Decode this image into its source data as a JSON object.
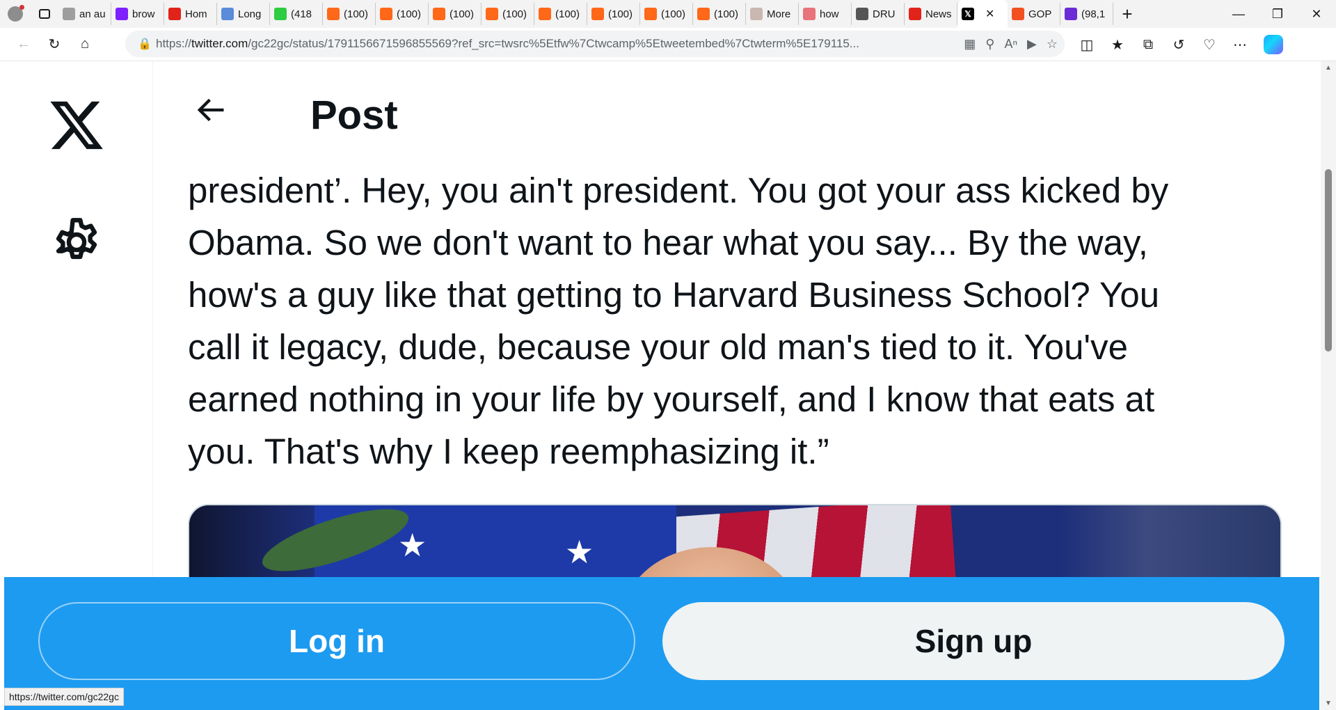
{
  "browser": {
    "tabs": [
      {
        "label": "an au",
        "icon": "page-icon",
        "color": "#9e9e9e"
      },
      {
        "label": "brow",
        "icon": "yahoo-icon",
        "color": "#7e1fff"
      },
      {
        "label": "Hom",
        "icon": "app-icon",
        "color": "#e2231a"
      },
      {
        "label": "Long",
        "icon": "five-icon",
        "color": "#5b8bd9"
      },
      {
        "label": "(418",
        "icon": "g-icon",
        "color": "#2ecc40"
      },
      {
        "label": "(100)",
        "icon": "substack-icon",
        "color": "#ff6719"
      },
      {
        "label": "(100)",
        "icon": "substack-icon",
        "color": "#ff6719"
      },
      {
        "label": "(100)",
        "icon": "substack-icon",
        "color": "#ff6719"
      },
      {
        "label": "(100)",
        "icon": "substack-icon",
        "color": "#ff6719"
      },
      {
        "label": "(100)",
        "icon": "substack-icon",
        "color": "#ff6719"
      },
      {
        "label": "(100)",
        "icon": "substack-icon",
        "color": "#ff6719"
      },
      {
        "label": "(100)",
        "icon": "substack-icon",
        "color": "#ff6719"
      },
      {
        "label": "(100)",
        "icon": "substack-icon",
        "color": "#ff6719"
      },
      {
        "label": "More",
        "icon": "bi-icon",
        "color": "#c9b8b0"
      },
      {
        "label": "how",
        "icon": "youtube-icon",
        "color": "#e8737a"
      },
      {
        "label": "DRU",
        "icon": "drudge-icon",
        "color": "#555555"
      },
      {
        "label": "News",
        "icon": "r-icon",
        "color": "#e2231a"
      },
      {
        "label": "",
        "icon": "x-icon",
        "color": "#000000",
        "active": true
      },
      {
        "label": "GOP",
        "icon": "microsoft-icon",
        "color": "#f25022"
      },
      {
        "label": "(98,1",
        "icon": "mail-icon",
        "color": "#6b2bd6"
      }
    ],
    "url_prefix": "https://",
    "url_host": "twitter.com",
    "url_rest": "/gc22gc/status/1791156671596855569?ref_src=twsrc%5Etfw%7Ctwcamp%5Etweetembed%7Ctwterm%5E179115...",
    "status_url": "https://twitter.com/gc22gc"
  },
  "post": {
    "header_title": "Post",
    "text_lines": [
      "president’. Hey, you ain't president. You got your ass kicked by",
      "Obama. So we don't want to hear what you say... By the way,",
      "how's a guy like that getting to Harvard Business School? You",
      "call it legacy, dude, because your old man's tied to it. You've",
      "earned nothing in your life by yourself, and I know that eats at",
      "you. That's why I keep reemphasizing it.”"
    ]
  },
  "cta": {
    "login_label": "Log in",
    "signup_label": "Sign up"
  },
  "colors": {
    "twitter_blue": "#1d9bf0",
    "text": "#0f1419",
    "signup_bg": "#eff3f4"
  }
}
